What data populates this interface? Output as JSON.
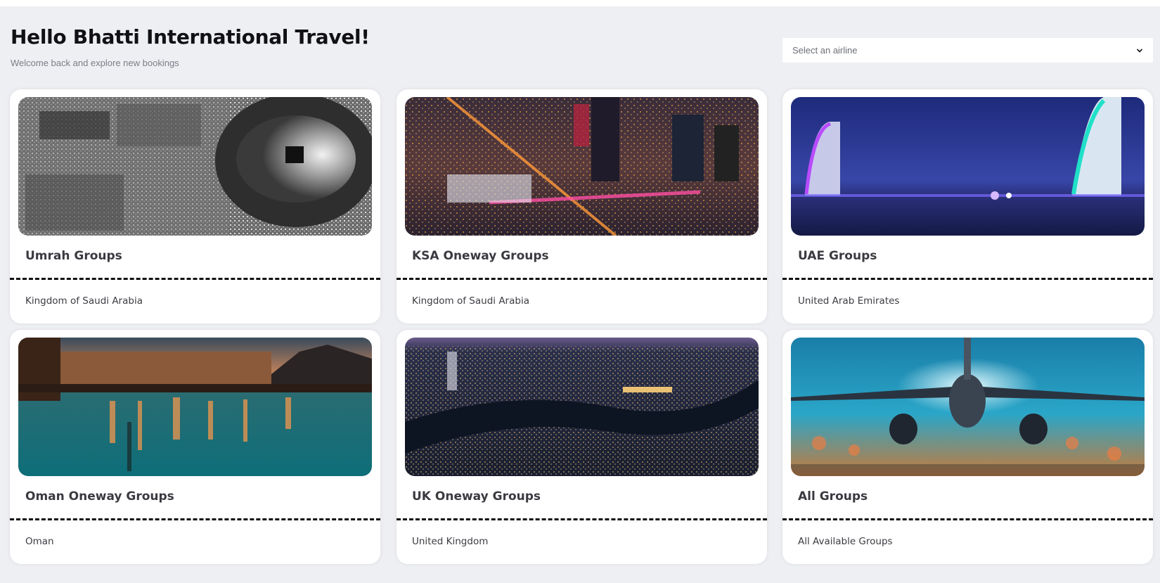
{
  "header": {
    "greeting": "Hello Bhatti International Travel!",
    "subtitle": "Welcome back and explore new bookings"
  },
  "airline_select": {
    "placeholder": "Select an airline",
    "icon": "chevron-down-icon"
  },
  "cards": [
    {
      "title": "Umrah Groups",
      "subtitle": "Kingdom of Saudi Arabia",
      "image": "makkah-haram-aerial"
    },
    {
      "title": "KSA Oneway Groups",
      "subtitle": "Kingdom of Saudi Arabia",
      "image": "riyadh-night-skyline"
    },
    {
      "title": "UAE Groups",
      "subtitle": "United Arab Emirates",
      "image": "dubai-burj-al-arab-night"
    },
    {
      "title": "Oman Oneway Groups",
      "subtitle": "Oman",
      "image": "muscat-corniche-dusk"
    },
    {
      "title": "UK Oneway Groups",
      "subtitle": "United Kingdom",
      "image": "london-thames-night"
    },
    {
      "title": "All Groups",
      "subtitle": "All Available Groups",
      "image": "airplane-runway-lights"
    }
  ],
  "colors": {
    "page_background": "#eeeff3",
    "card_background": "#ffffff",
    "divider": "#111111"
  }
}
